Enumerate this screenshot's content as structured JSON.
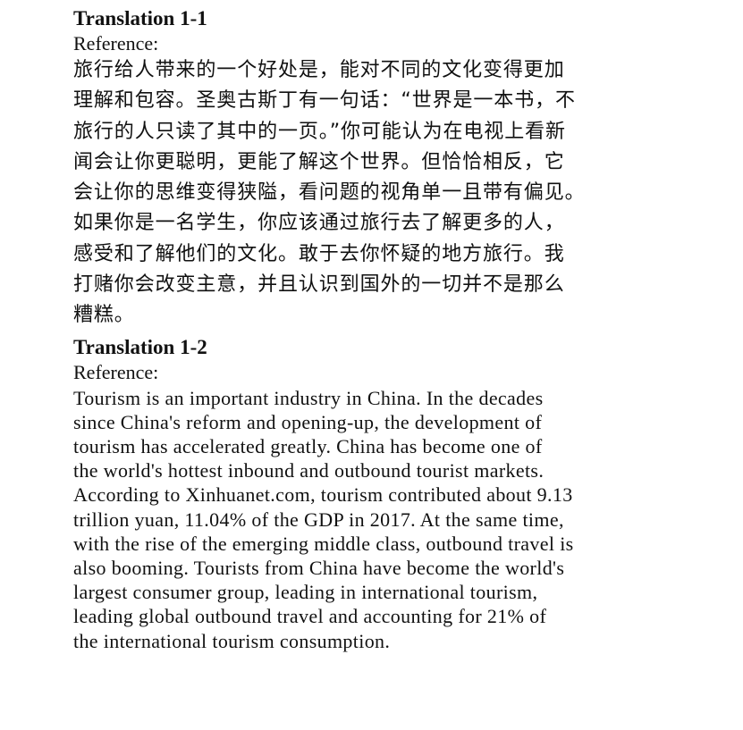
{
  "sections": [
    {
      "title": "Translation 1-1",
      "label": "Reference:",
      "lines": [
        "旅行给人带来的一个好处是，能对不同的文化变得更加",
        "理解和包容。圣奥古斯丁有一句话：“世界是一本书，不",
        "旅行的人只读了其中的一页。”你可能认为在电视上看新",
        "闻会让你更聪明，更能了解这个世界。但恰恰相反，它",
        "会让你的思维变得狭隘，看问题的视角单一且带有偏见。",
        "如果你是一名学生，你应该通过旅行去了解更多的人，",
        "感受和了解他们的文化。敢于去你怀疑的地方旅行。我",
        "打赌你会改变主意，并且认识到国外的一切并不是那么",
        "糟糕。"
      ]
    },
    {
      "title": "Translation 1-2",
      "label": "Reference:",
      "lines": [
        "Tourism is an important industry in China. In the decades",
        "since China's reform and opening-up, the development of",
        "tourism has accelerated greatly. China has become one of",
        "the world's hottest inbound and outbound tourist markets.",
        "According to Xinhuanet.com, tourism contributed about 9.13",
        "trillion yuan, 11.04% of the GDP in 2017. At the same time,",
        "with the rise of the emerging middle class, outbound travel is",
        "also booming. Tourists from China have become the world's",
        "largest consumer group, leading in international tourism,",
        "leading global outbound travel and accounting for 21% of",
        "the international tourism consumption."
      ]
    }
  ]
}
